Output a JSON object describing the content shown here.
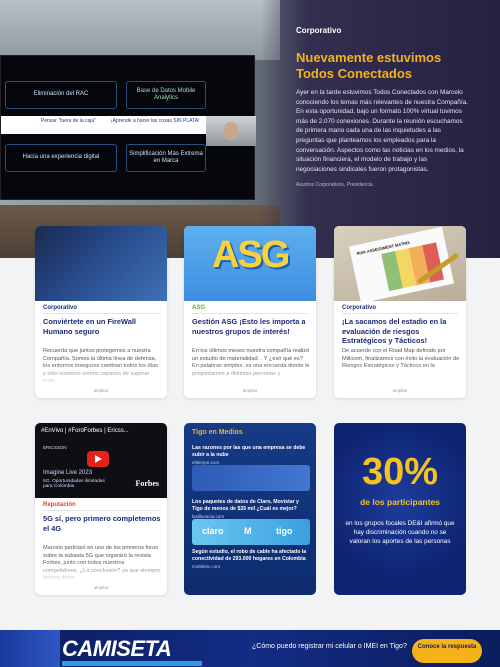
{
  "hero": {
    "tag": "Corporativo",
    "title": "Nuevamente estuvimos Todos Conectados",
    "body": "Ayer en la tarde estuvimos Todos Conectados con Marcelo conociendo los temas más relevantes de nuestra Compañía. En esta oportunidad, bajo un formato 100% virtual tuvimos más de 2.070 conexiones. Durante la reunión escuchamos de primera mano cada una de las inquietudes a las preguntas que planteamos los empleados para la conversación. Aspectos como las noticias en los medios, la situación financiera, el modelo de trabajo y las negociaciones sindicales fueron protagonistas.",
    "footer": "Asuntos Corporativos, Presidencia",
    "screen": {
      "cell1": "Eliminación del RAC",
      "cell2": "Base de Datos Mobile Analytics",
      "white1": "Pensar \"fuera de la caja\"",
      "white2": "¡Aprende a hacer las cosas SIN PLATA!",
      "cell4": "Hacia una experiencia digital",
      "cell5": "Simplificación Más Extrema en Marca"
    }
  },
  "cards": [
    {
      "tag": "Corporativo",
      "tag_color": "#1b2b7a",
      "title": "Conviértete en un FireWall Humano seguro",
      "desc": "Recuerda que juntos protegemos a nuestra Compañía. Somos la última línea de defensa, los entornos inseguros cambian todos los días y sólo nosotros somos capaces de superar esas",
      "more": "ampliar"
    },
    {
      "tag": "ASG",
      "tag_color": "#6aa82e",
      "image_text": "ASG",
      "title": "Gestión ASG ¡Esto les importa a nuestros grupos de interés!",
      "desc": "En los últimos meses nuestra compañía realizó un estudio de materialidad. . Y ¿esó qué es? En palabras simples, es una encuesta donde le preguntamos a distintas personas y",
      "more": "ampliar"
    },
    {
      "tag": "Corporativo",
      "tag_color": "#1b2b7a",
      "image_text": "RISK ASSESSMENT MATRIX",
      "title": "¡La sacamos del estadio en la evaluación de riesgos Estratégicos y Tácticos!",
      "desc": "De acuerdo con el Road Map definido por Millicom, finalizamos con éxito la evaluación de Riesgos Estratégicos y Tácticos en la",
      "more": "ampliar"
    },
    {
      "tag": "Reputación",
      "tag_color": "#d9452b",
      "video_title": "#EnVivo | #ForoForbes | Ericss...",
      "video_brand": "ERICSSON",
      "video_line1": "Imagine Live 2023",
      "video_line2": "5G: Oportunidades ilimitadas para Colombia",
      "video_forbes": "Forbes",
      "title": "5G sí, pero primero completemos el 4G",
      "desc": "Marcelo participó en uno de los primeros foros sobre la subasta 5G que organizó la revista Forbes, junto con todos nuestros competidores. ¿La conclusión? ya que siempre hemos dicho",
      "more": "ampliar"
    }
  ],
  "media": {
    "heading": "Tigo en Medios",
    "items": [
      {
        "title": "Las razones por las que una empresa se debe subir a la nube",
        "source": "eltiempo.com"
      },
      {
        "title": "Los paquetes de datos de Claro, Movistar y Tigo de menos de $35 mil ¿Cuál es mejor?",
        "source": "lasillavacia.com"
      },
      {
        "title": "Según estudio, el robo de cable ha afectado la conectividad de 293.000 hogares en Colombia",
        "source": "mobiletic.com"
      }
    ],
    "logos": [
      "claro",
      "M",
      "tigo"
    ]
  },
  "stat": {
    "value": "30%",
    "subtitle": "de los participantes",
    "description": "en los grupos focales DE&I afirmó que hay discriminación cuando no se valoran los aportes de las personas"
  },
  "banner": {
    "headline": "CAMISETA",
    "question": "¿Cómo puedo registrar mi celular o IMEI en Tigo?",
    "button": "Conoce la respuesta"
  },
  "colors": {
    "accent": "#f5b21a",
    "navy": "#1b2b7a"
  }
}
